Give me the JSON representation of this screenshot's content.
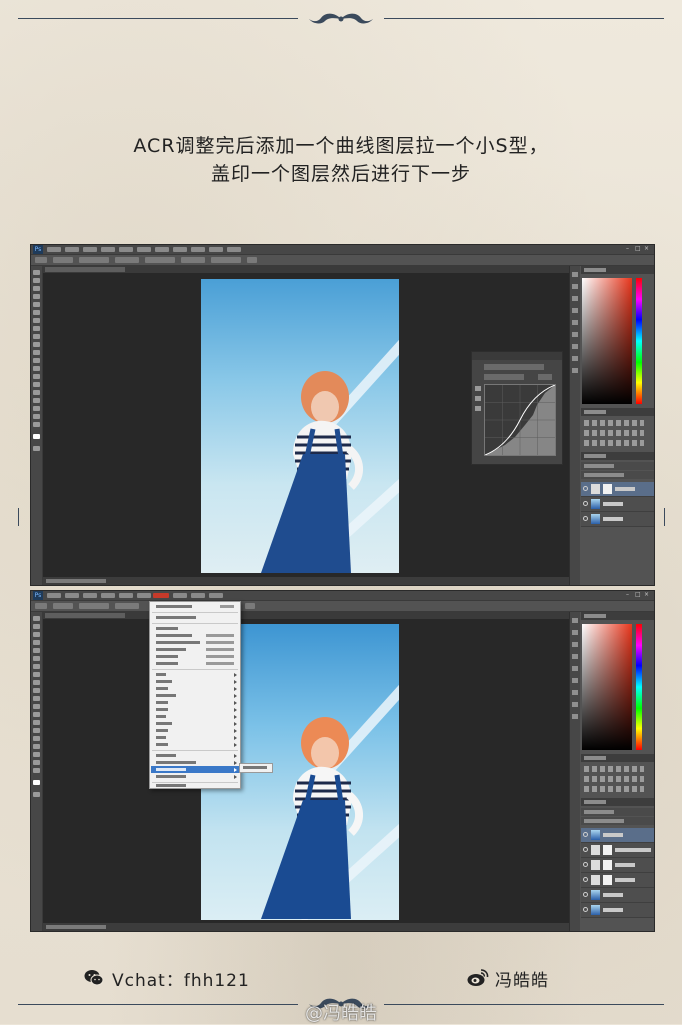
{
  "caption": {
    "line1": "ACR调整完后添加一个曲线图层拉一个小S型，",
    "line2": "盖印一个图层然后进行下一步"
  },
  "footer": {
    "wechat_icon": "wechat-icon",
    "wechat_text": "Vchat：fhh121",
    "weibo_icon": "weibo-icon",
    "weibo_text": "冯皓皓",
    "watermark": "@冯皓皓"
  },
  "colors": {
    "paper": "#ece5d8",
    "ornament": "#3b4a5c",
    "ps_dark": "#535353",
    "menu_highlight": "#3a78c8"
  }
}
